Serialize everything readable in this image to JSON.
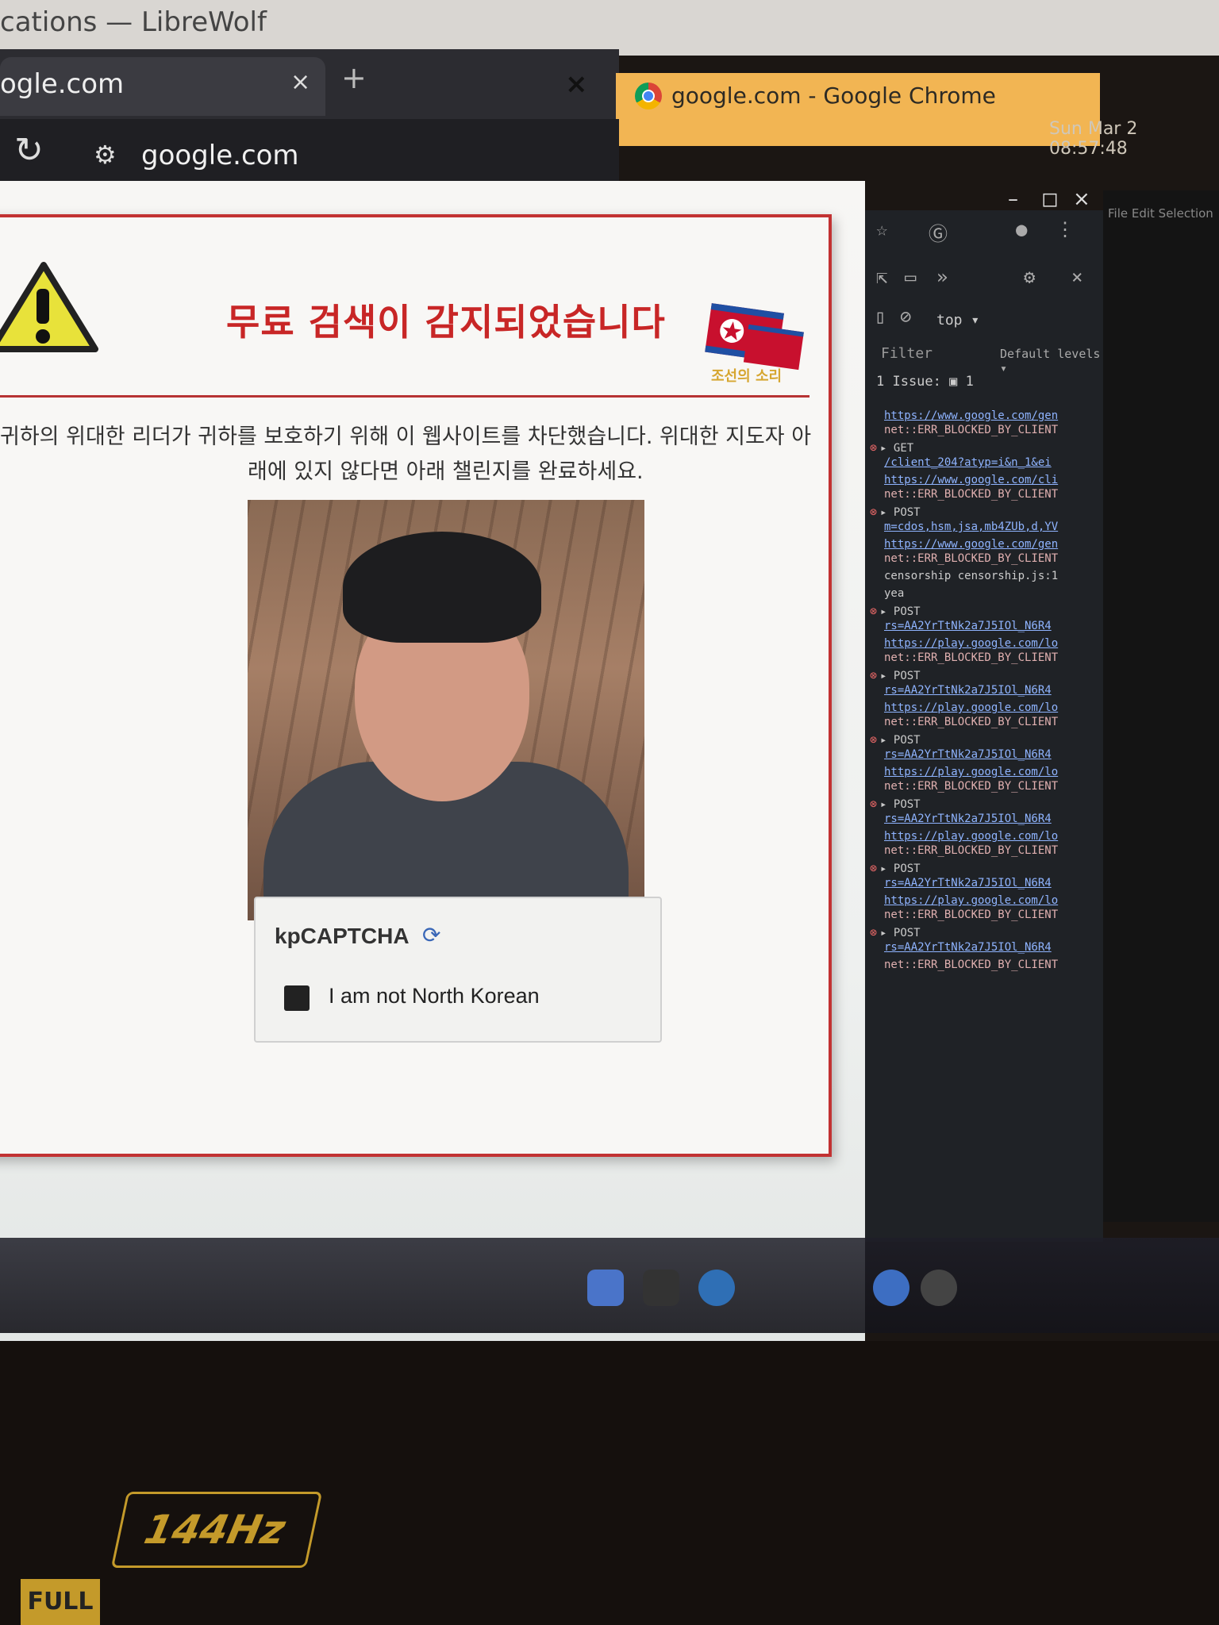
{
  "window": {
    "librewolf_title": "cations — LibreWolf",
    "tab_title": "ogle.com",
    "tab_close": "×",
    "new_tab": "+",
    "libre_close": "×",
    "url": "google.com",
    "chrome_title": "google.com - Google Chrome",
    "chrome_close": "×",
    "clock": "Sun Mar 2  08:57:48",
    "win_min": "–",
    "win_max": "◻",
    "win_close": "×"
  },
  "page": {
    "headline": "무료 검색이 감지되었습니다",
    "body_line_1": "귀하의 위대한 리더가 귀하를 보호하기 위해 이 웹사이트를 차단했습니다. 위대한 지도자 아",
    "body_line_2": "래에 있지 않다면 아래 챌린지를 완료하세요.",
    "flag_caption": "조선의 소리",
    "captcha": {
      "brand": "kpCAPTCHA",
      "label": "I am not North Korean",
      "checked": false
    }
  },
  "devtools": {
    "context": "top ▾",
    "filter_placeholder": "Filter",
    "levels": "Default levels ▾",
    "issues": "1 Issue:  ▣ 1",
    "entries": [
      {
        "method": "",
        "url": "https://www.google.com/gen",
        "msg": "net::ERR_BLOCKED_BY_CLIENT"
      },
      {
        "method": "▸ GET",
        "url": "/client_204?atyp=i&n_1&ei",
        "msg": ""
      },
      {
        "method": "",
        "url": "https://www.google.com/cli",
        "msg": "net::ERR_BLOCKED_BY_CLIENT"
      },
      {
        "method": "▸ POST",
        "url": "m=cdos,hsm,jsa,mb4ZUb,d,YV",
        "msg": ""
      },
      {
        "method": "",
        "url": "https://www.google.com/gen",
        "msg": "net::ERR_BLOCKED_BY_CLIENT"
      },
      {
        "method": "",
        "url": "",
        "msg": "",
        "plain": "censorship  censorship.js:1"
      },
      {
        "method": "",
        "url": "",
        "msg": "",
        "plain": "yea"
      },
      {
        "method": "▸ POST",
        "url": "rs=AA2YrTtNk2a7J5IOl_N6R4",
        "msg": ""
      },
      {
        "method": "",
        "url": "https://play.google.com/lo",
        "msg": "net::ERR_BLOCKED_BY_CLIENT"
      },
      {
        "method": "▸ POST",
        "url": "rs=AA2YrTtNk2a7J5IOl_N6R4",
        "msg": ""
      },
      {
        "method": "",
        "url": "https://play.google.com/lo",
        "msg": "net::ERR_BLOCKED_BY_CLIENT"
      },
      {
        "method": "▸ POST",
        "url": "rs=AA2YrTtNk2a7J5IOl_N6R4",
        "msg": ""
      },
      {
        "method": "",
        "url": "https://play.google.com/lo",
        "msg": "net::ERR_BLOCKED_BY_CLIENT"
      },
      {
        "method": "▸ POST",
        "url": "rs=AA2YrTtNk2a7J5IOl_N6R4",
        "msg": ""
      },
      {
        "method": "",
        "url": "https://play.google.com/lo",
        "msg": "net::ERR_BLOCKED_BY_CLIENT"
      },
      {
        "method": "▸ POST",
        "url": "rs=AA2YrTtNk2a7J5IOl_N6R4",
        "msg": ""
      },
      {
        "method": "",
        "url": "https://play.google.com/lo",
        "msg": "net::ERR_BLOCKED_BY_CLIENT"
      },
      {
        "method": "▸ POST",
        "url": "rs=AA2YrTtNk2a7J5IOl_N6R4",
        "msg": ""
      },
      {
        "method": "",
        "url": "",
        "msg": "net::ERR_BLOCKED_BY_CLIENT"
      }
    ]
  },
  "vscode": {
    "menu": "File  Edit  Selection"
  },
  "bezel": {
    "refresh": "144Hz",
    "fhd": "FULL"
  },
  "colors": {
    "accent_red": "#c82626",
    "chrome_titlebar": "#f2b553",
    "error_red": "#e26565"
  }
}
